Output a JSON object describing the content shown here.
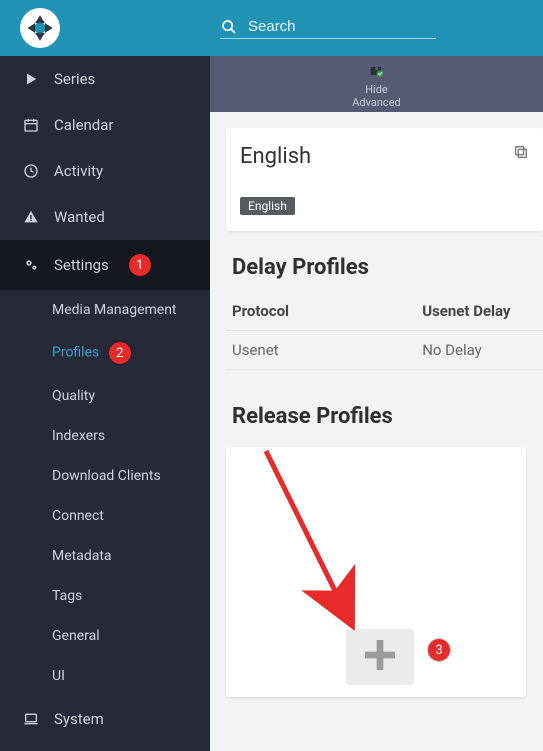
{
  "search": {
    "placeholder": "Search"
  },
  "subheader": {
    "line1": "Hide",
    "line2": "Advanced"
  },
  "sidebar": {
    "series": "Series",
    "calendar": "Calendar",
    "activity": "Activity",
    "wanted": "Wanted",
    "settings": "Settings",
    "system": "System",
    "subs": {
      "media_management": "Media Management",
      "profiles": "Profiles",
      "quality": "Quality",
      "indexers": "Indexers",
      "download_clients": "Download Clients",
      "connect": "Connect",
      "metadata": "Metadata",
      "tags": "Tags",
      "general": "General",
      "ui": "UI"
    }
  },
  "markers": {
    "m1": "1",
    "m2": "2",
    "m3": "3"
  },
  "language_card": {
    "title": "English",
    "chip": "English"
  },
  "delay_profiles": {
    "heading": "Delay Profiles",
    "col_protocol": "Protocol",
    "col_usenet_delay": "Usenet Delay",
    "row1_protocol": "Usenet",
    "row1_delay": "No Delay"
  },
  "release_profiles": {
    "heading": "Release Profiles"
  }
}
